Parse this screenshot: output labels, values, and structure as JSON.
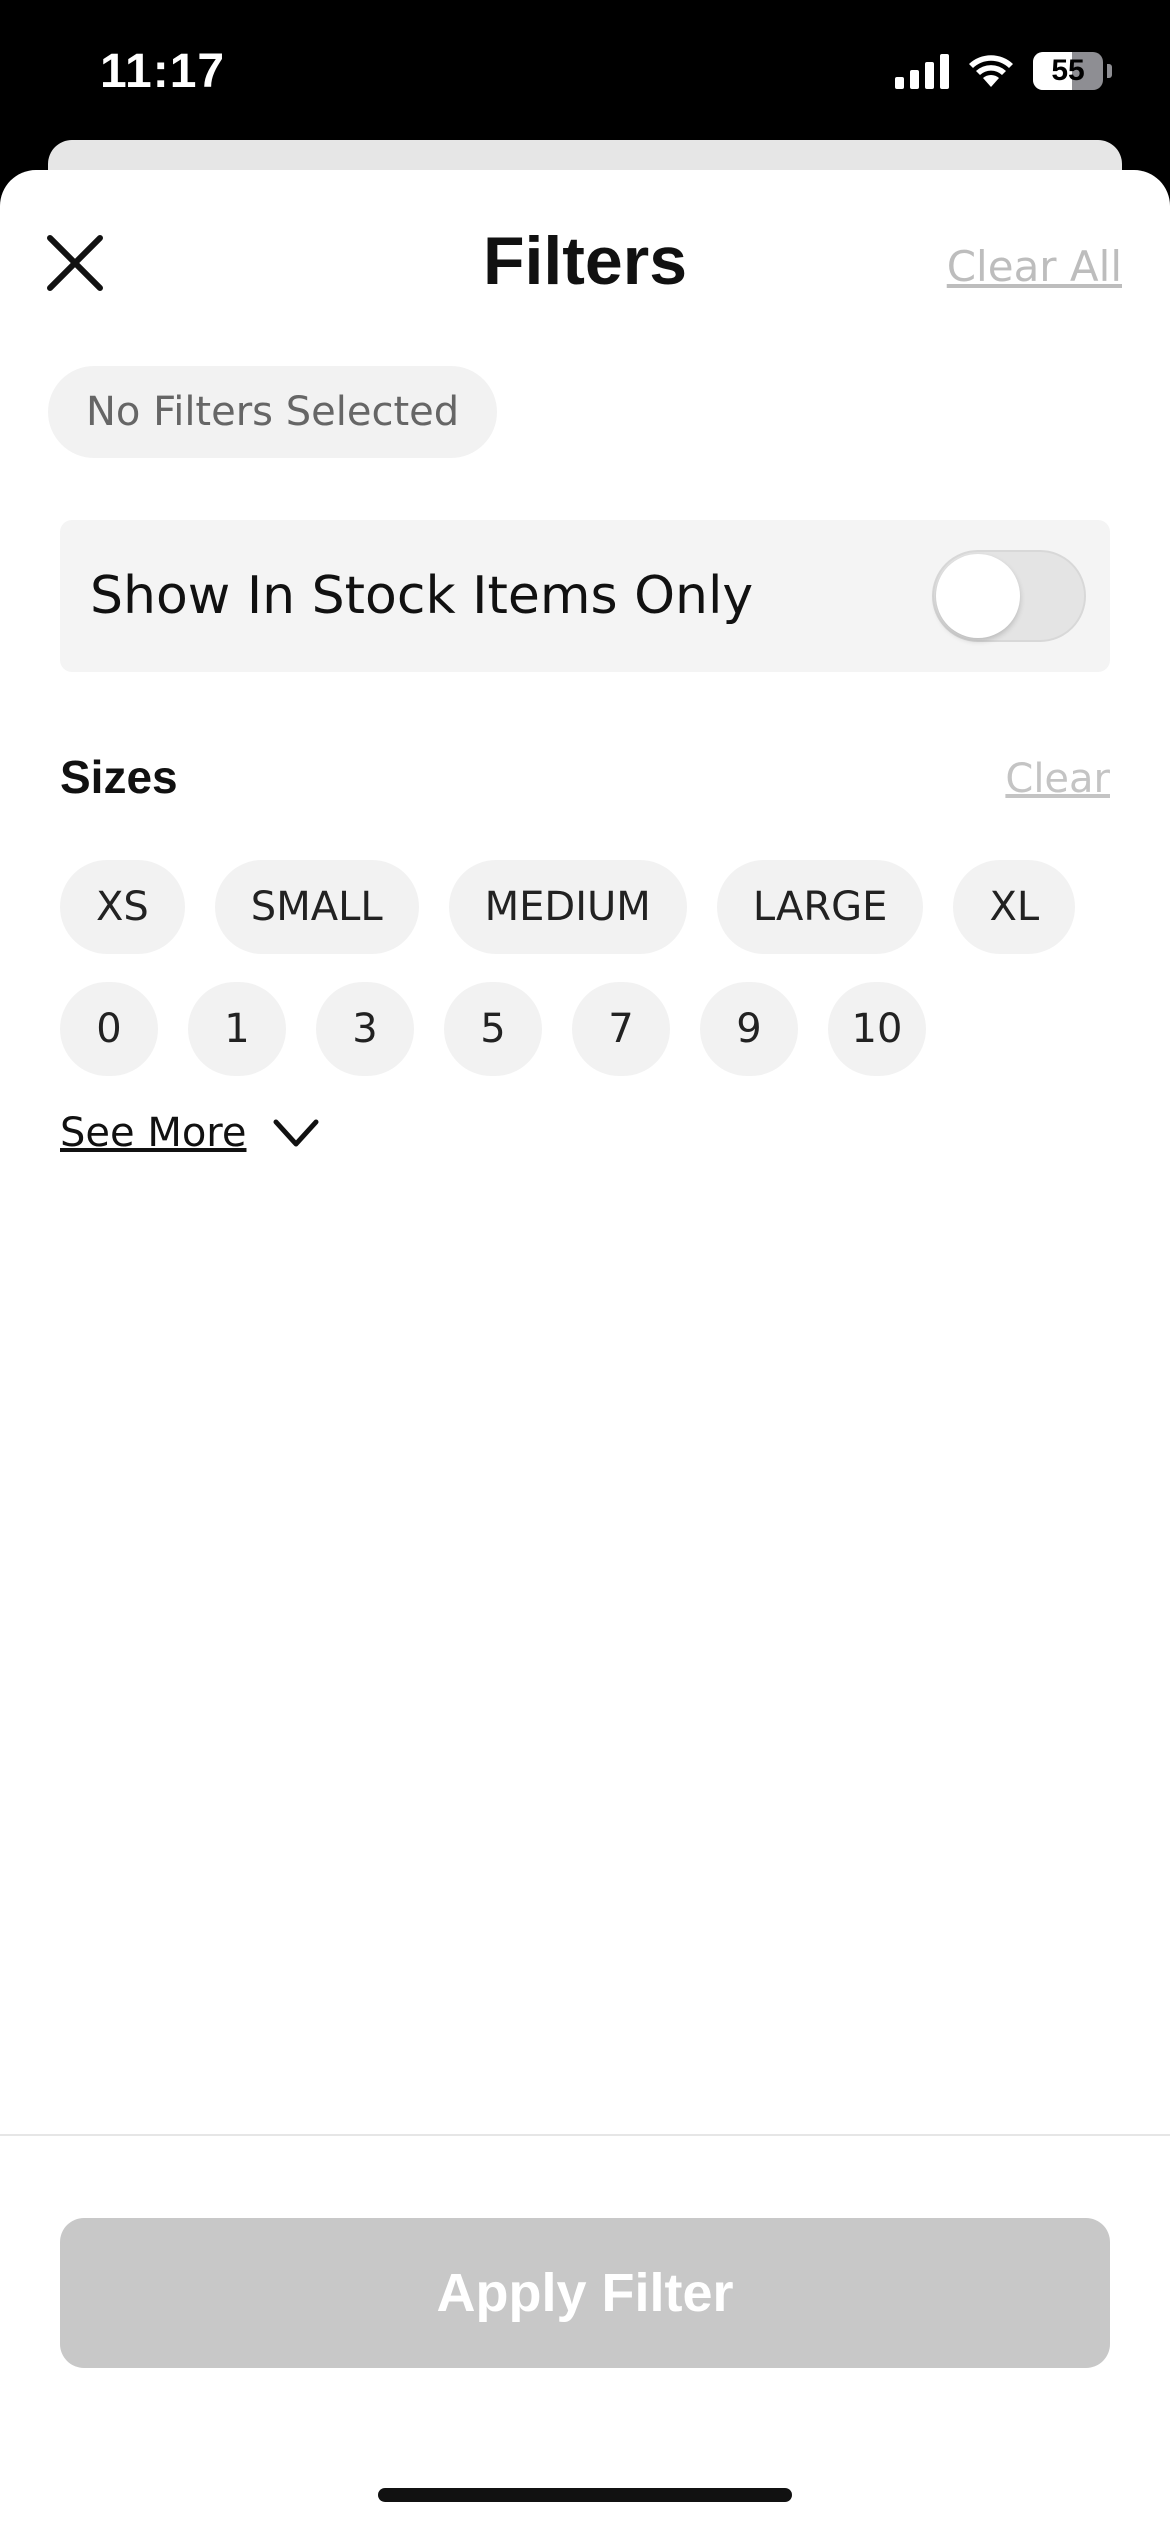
{
  "status_bar": {
    "time": "11:17",
    "battery_percent": "55",
    "battery_level": 0.55
  },
  "header": {
    "title": "Filters",
    "close_icon": "close-icon",
    "clear_all_label": "Clear All"
  },
  "selected_filters": {
    "empty_label": "No Filters Selected"
  },
  "stock_toggle": {
    "label": "Show In Stock Items Only",
    "on": false
  },
  "sizes": {
    "title": "Sizes",
    "clear_label": "Clear",
    "letter_sizes": [
      "XS",
      "SMALL",
      "MEDIUM",
      "LARGE",
      "XL"
    ],
    "number_sizes": [
      "0",
      "1",
      "3",
      "5",
      "7",
      "9",
      "10"
    ],
    "see_more_label": "See More",
    "see_more_icon": "chevron-down-icon"
  },
  "footer": {
    "apply_label": "Apply Filter"
  },
  "colors": {
    "disabled_button": "#c8c8c8",
    "chip_background": "#f2f2f2",
    "muted_link": "#bdbdbd"
  }
}
